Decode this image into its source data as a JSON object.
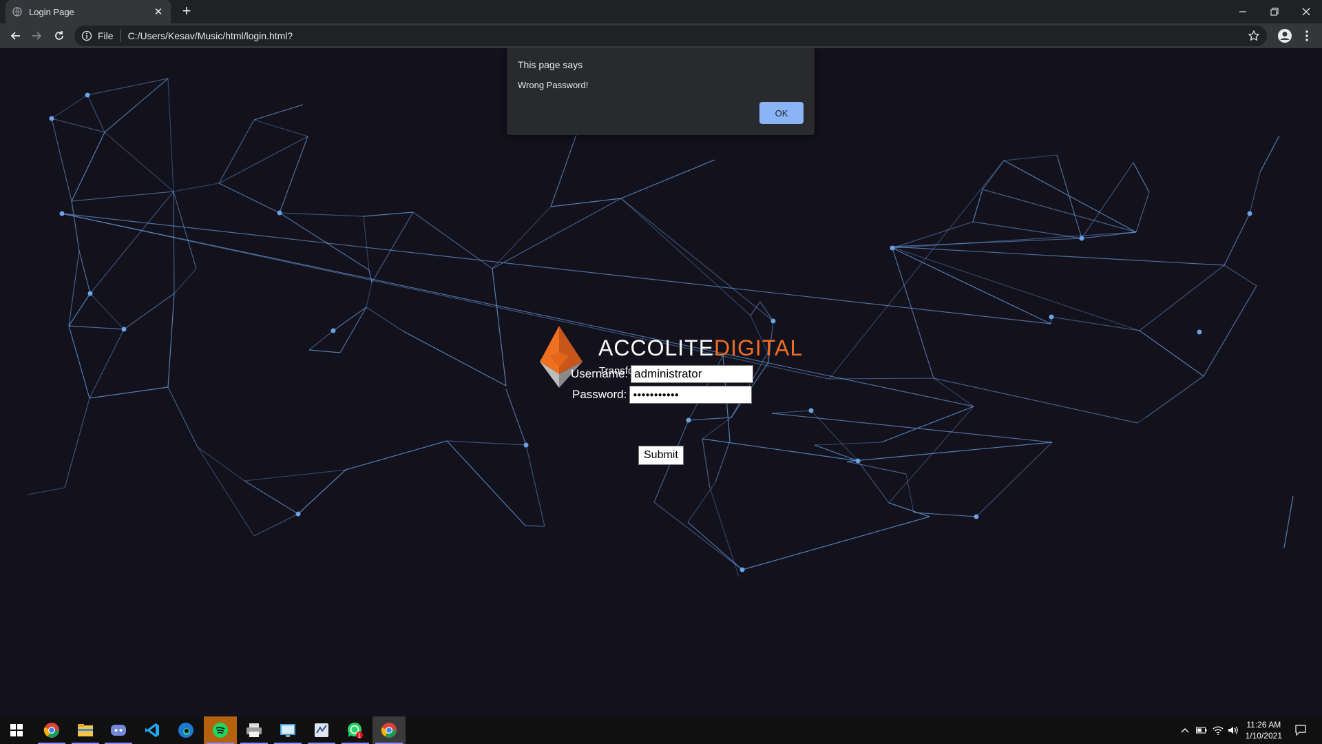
{
  "browser": {
    "tab_title": "Login Page",
    "new_tab": "+",
    "close_tab": "✕",
    "address_scheme": "File",
    "address_url": "C:/Users/Kesav/Music/html/login.html?"
  },
  "logo": {
    "brand_part1": "ACCOLITE",
    "brand_part2": "DIGITAL",
    "tagline": "Transforming The Future, Now",
    "colors": {
      "orange": "#f07021",
      "white": "#ffffff",
      "grey": "#9a9a9a"
    }
  },
  "form": {
    "username_label": "Username:",
    "username_value": "administrator",
    "password_label": "Password:",
    "password_value": "●●●●●●●●●●●",
    "submit_label": "Submit"
  },
  "dialog": {
    "title": "This page says",
    "message": "Wrong Password!",
    "ok_label": "OK"
  },
  "taskbar": {
    "apps": [
      "start-icon",
      "chrome-icon",
      "file-explorer-icon",
      "discord-icon",
      "vscode-icon",
      "edge-icon",
      "spotify-icon",
      "printer-icon",
      "control-panel-icon",
      "sublime-icon",
      "whatsapp-icon",
      "chrome-active-icon"
    ],
    "whatsapp_badge": "1",
    "time": "11:26 AM",
    "date": "1/10/2021"
  },
  "colors": {
    "background": "#13111c",
    "network_line": "#6aa3e6",
    "dialog_ok": "#8ab4f8"
  }
}
